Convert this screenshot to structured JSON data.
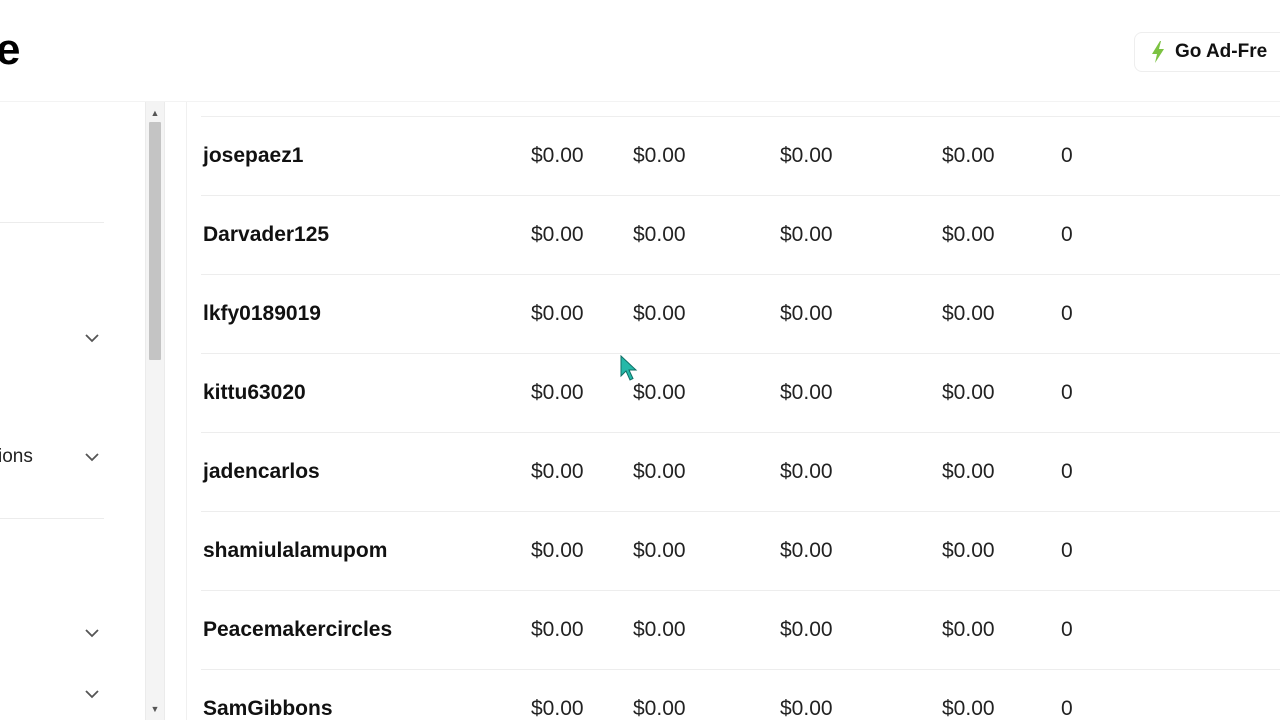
{
  "header": {
    "title_fragment": "e",
    "ad_free_label": "Go Ad-Fre",
    "bolt_color": "#7cc242"
  },
  "sidebar": {
    "partial_label": "ions"
  },
  "table": {
    "rows": [
      {
        "username": "josepaez1",
        "col1": "$0.00",
        "col2": "$0.00",
        "col3": "$0.00",
        "col4": "$0.00",
        "col5": "0"
      },
      {
        "username": "Darvader125",
        "col1": "$0.00",
        "col2": "$0.00",
        "col3": "$0.00",
        "col4": "$0.00",
        "col5": "0"
      },
      {
        "username": "lkfy0189019",
        "col1": "$0.00",
        "col2": "$0.00",
        "col3": "$0.00",
        "col4": "$0.00",
        "col5": "0"
      },
      {
        "username": "kittu63020",
        "col1": "$0.00",
        "col2": "$0.00",
        "col3": "$0.00",
        "col4": "$0.00",
        "col5": "0"
      },
      {
        "username": "jadencarlos",
        "col1": "$0.00",
        "col2": "$0.00",
        "col3": "$0.00",
        "col4": "$0.00",
        "col5": "0"
      },
      {
        "username": "shamiulalamupom",
        "col1": "$0.00",
        "col2": "$0.00",
        "col3": "$0.00",
        "col4": "$0.00",
        "col5": "0"
      },
      {
        "username": "Peacemakercircles",
        "col1": "$0.00",
        "col2": "$0.00",
        "col3": "$0.00",
        "col4": "$0.00",
        "col5": "0"
      },
      {
        "username": "SamGibbons",
        "col1": "$0.00",
        "col2": "$0.00",
        "col3": "$0.00",
        "col4": "$0.00",
        "col5": "0"
      }
    ]
  },
  "icons": {
    "bolt": "lightning-bolt-icon",
    "chevron": "chevron-down-icon",
    "cursor": "mouse-pointer-icon"
  }
}
